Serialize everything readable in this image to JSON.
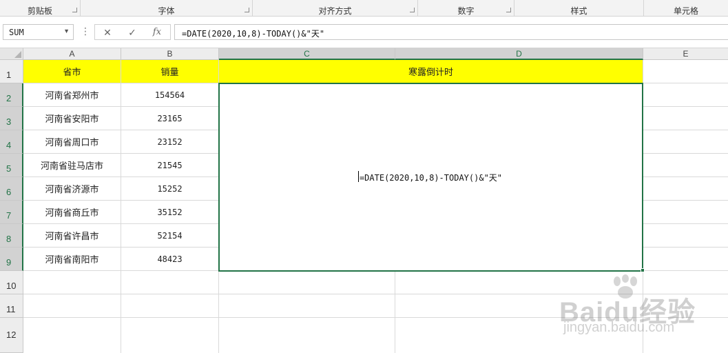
{
  "ribbon": {
    "groups": [
      {
        "label": "剪贴板"
      },
      {
        "label": "字体"
      },
      {
        "label": "对齐方式"
      },
      {
        "label": "数字"
      },
      {
        "label": "样式"
      },
      {
        "label": "单元格"
      }
    ]
  },
  "formula_bar": {
    "name_box": "SUM",
    "cancel_icon": "✕",
    "enter_icon": "✓",
    "fx_label": "fx",
    "formula": "=DATE(2020,10,8)-TODAY()&\"天\""
  },
  "columns": [
    "A",
    "B",
    "C",
    "D",
    "E"
  ],
  "rows": [
    "1",
    "2",
    "3",
    "4",
    "5",
    "6",
    "7",
    "8",
    "9",
    "10",
    "11",
    "12"
  ],
  "table": {
    "headers": {
      "province": "省市",
      "sales": "销量",
      "countdown": "寒露倒计时"
    },
    "data": [
      {
        "province": "河南省郑州市",
        "sales": "154564"
      },
      {
        "province": "河南省安阳市",
        "sales": "23165"
      },
      {
        "province": "河南省周口市",
        "sales": "23152"
      },
      {
        "province": "河南省驻马店市",
        "sales": "21545"
      },
      {
        "province": "河南省济源市",
        "sales": "15252"
      },
      {
        "province": "河南省商丘市",
        "sales": "35152"
      },
      {
        "province": "河南省许昌市",
        "sales": "52154"
      },
      {
        "province": "河南省南阳市",
        "sales": "48423"
      }
    ],
    "editing_cell_formula": "=DATE(2020,10,8)-TODAY()&\"天\""
  },
  "watermark": {
    "brand": "Baidu经验",
    "url": "jingyan.baidu.com"
  },
  "colors": {
    "accent": "#217346",
    "header_fill": "#ffff00"
  }
}
